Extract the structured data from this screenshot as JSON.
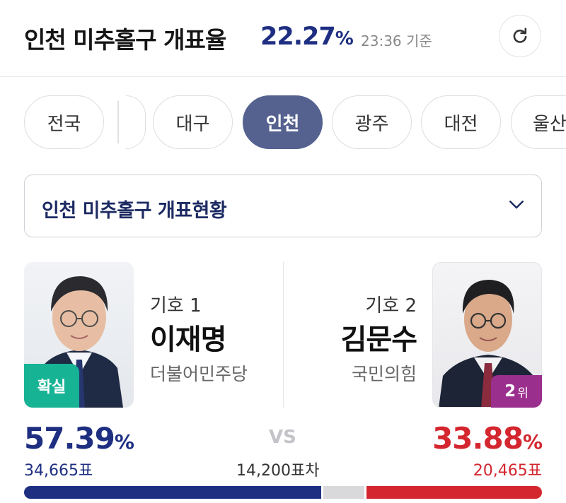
{
  "header": {
    "title": "인천 미추홀구 개표율",
    "rate_value": "22.27",
    "rate_unit": "%",
    "timestamp": "23:36 기준"
  },
  "regions": [
    "전국",
    "대구",
    "인천",
    "광주",
    "대전",
    "울산"
  ],
  "active_region": "인천",
  "dropdown": {
    "label": "인천 미추홀구 개표현황"
  },
  "candidates": [
    {
      "number_label": "기호 1",
      "name": "이재명",
      "party": "더불어민주당",
      "badge": "확실",
      "percent": "57.39",
      "percent_unit": "%",
      "votes": "34,665표",
      "color": "#1e2f82"
    },
    {
      "number_label": "기호 2",
      "name": "김문수",
      "party": "국민의힘",
      "badge_rank": "2",
      "badge_suffix": "위",
      "percent": "33.88",
      "percent_unit": "%",
      "votes": "20,465표",
      "color": "#d4262f"
    }
  ],
  "vs_label": "VS",
  "vote_gap": "14,200표차",
  "share_bar": {
    "left_fraction": 0.5739,
    "right_fraction": 0.3388,
    "other_color": "#d9d9dc"
  }
}
